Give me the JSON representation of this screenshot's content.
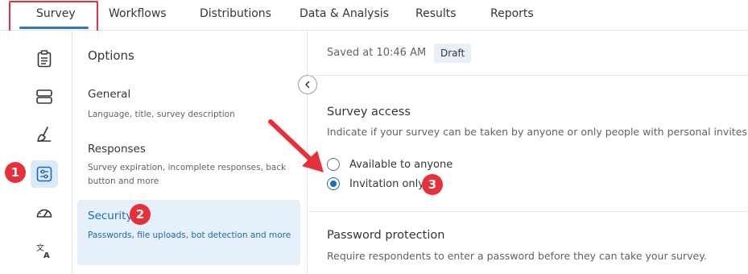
{
  "tabs": [
    {
      "label": "Survey",
      "active": true
    },
    {
      "label": "Workflows"
    },
    {
      "label": "Distributions"
    },
    {
      "label": "Data & Analysis"
    },
    {
      "label": "Results"
    },
    {
      "label": "Reports"
    }
  ],
  "rail": {
    "items": [
      {
        "icon": "clipboard-icon"
      },
      {
        "icon": "layout-icon"
      },
      {
        "icon": "brush-icon"
      },
      {
        "icon": "sliders-icon",
        "active": true
      },
      {
        "icon": "gauge-icon"
      },
      {
        "icon": "translate-icon"
      }
    ]
  },
  "options": {
    "title": "Options",
    "items": [
      {
        "label": "General",
        "description": "Language, title, survey description"
      },
      {
        "label": "Responses",
        "description": "Survey expiration, incomplete responses, back button and more"
      },
      {
        "label": "Security",
        "description": "Passwords, file uploads, bot detection and more",
        "selected": true
      }
    ]
  },
  "status": {
    "saved_text": "Saved at 10:46 AM",
    "badge": "Draft"
  },
  "survey_access": {
    "title": "Survey access",
    "description": "Indicate if your survey can be taken by anyone or only people with personal invites.",
    "options": [
      {
        "label": "Available to anyone",
        "checked": false
      },
      {
        "label": "Invitation only",
        "checked": true
      }
    ]
  },
  "password_protection": {
    "title": "Password protection",
    "description": "Require respondents to enter a password before they can take your survey."
  },
  "markers": [
    "1",
    "2",
    "3"
  ],
  "colors": {
    "accent": "#1a6bbd",
    "highlight_red": "#e8303a",
    "selected_bg": "#e6f0fb"
  }
}
